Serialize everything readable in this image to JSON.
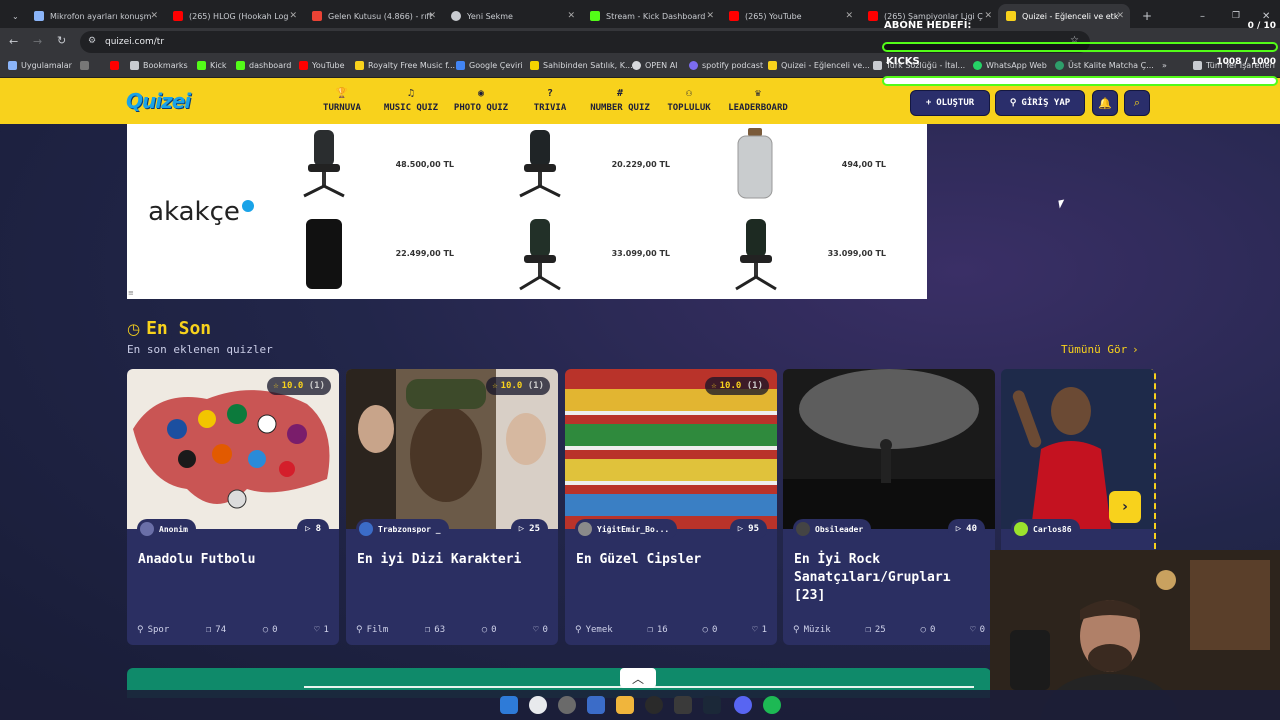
{
  "tabs": [
    {
      "title": "Mikrofon ayarları konuşm",
      "color": "#8ab4f8"
    },
    {
      "title": "(265) HLOG (Hookah Log",
      "color": "#ff0000"
    },
    {
      "title": "Gelen Kutusu (4.866) - rıft",
      "color": "#ea4335"
    },
    {
      "title": "Yeni Sekme",
      "color": "#c8cbd0"
    },
    {
      "title": "Stream - Kick Dashboard",
      "color": "#53fc18"
    },
    {
      "title": "(265) YouTube",
      "color": "#ff0000"
    },
    {
      "title": "(265) Şampiyonlar Ligi Ç",
      "color": "#ff0000"
    },
    {
      "title": "Quizei - Eğlenceli ve etk",
      "color": "#f8d21c"
    }
  ],
  "address": "quizei.com/tr",
  "bookmarks": [
    {
      "label": "Uygulamalar",
      "color": "#8ab4f8"
    },
    {
      "label": "",
      "color": "#ff0000"
    },
    {
      "label": "Bookmarks",
      "color": "#c8cbd0"
    },
    {
      "label": "Kick",
      "color": "#53fc18"
    },
    {
      "label": "dashboard",
      "color": "#53fc18"
    },
    {
      "label": "YouTube",
      "color": "#ff0000"
    },
    {
      "label": "Royalty Free Music f...",
      "color": "#f8d21c"
    },
    {
      "label": "Google Çeviri",
      "color": "#4285f4"
    },
    {
      "label": "Sahibinden Satılık, K...",
      "color": "#f5d300"
    },
    {
      "label": "OPEN AI",
      "color": "#d6d8dc"
    },
    {
      "label": "spotify podcast",
      "color": "#7c6cf0"
    },
    {
      "label": "Quizei - Eğlenceli ve...",
      "color": "#f8d21c"
    },
    {
      "label": "Türk Sözlüğü - İtal...",
      "color": "#c8cbd0"
    },
    {
      "label": "WhatsApp Web",
      "color": "#25d366"
    },
    {
      "label": "Üst Kalite Matcha Ç...",
      "color": "#2e9e6a"
    },
    {
      "label": "Tüm Yer İşaretleri",
      "color": "#c8cbd0"
    }
  ],
  "overlay": {
    "abone_label": "ABONE HEDEFİ:",
    "abone_count": "0 / 10",
    "kicks_label": "KICKS",
    "kicks_count": "1008 / 1000"
  },
  "site": {
    "logo": "Quizei",
    "nav": [
      {
        "label": "TURNUVA",
        "icon": "🏆"
      },
      {
        "label": "MUSIC QUIZ",
        "icon": "♫"
      },
      {
        "label": "PHOTO QUIZ",
        "icon": "◉"
      },
      {
        "label": "TRIVIA",
        "icon": "?"
      },
      {
        "label": "NUMBER QUIZ",
        "icon": "#"
      },
      {
        "label": "TOPLULUK",
        "icon": "⚇"
      },
      {
        "label": "LEADERBOARD",
        "icon": "♛"
      }
    ],
    "create_label": "OLUŞTUR",
    "login_label": "GİRİŞ YAP"
  },
  "ads": {
    "brand": "akakçe",
    "products": [
      {
        "price": "48.500,00 TL"
      },
      {
        "price": "20.229,00 TL"
      },
      {
        "price": "494,00 TL"
      },
      {
        "price": "22.499,00 TL"
      },
      {
        "price": "33.099,00 TL"
      },
      {
        "price": "33.099,00 TL"
      }
    ]
  },
  "section": {
    "title": "En Son",
    "subtitle": "En son eklenen quizler",
    "see_all": "Tümünü Gör"
  },
  "cards": [
    {
      "title": "Anadolu Futbolu",
      "rating": "10.0",
      "rating_count": "(1)",
      "author": "Anonim",
      "plays": "8",
      "category": "Spor",
      "questions": "74",
      "comments": "0",
      "likes": "1",
      "thumb": "#d9d2c8",
      "avatar": "#6a6fa8"
    },
    {
      "title": "En iyi Dizi Karakteri",
      "rating": "10.0",
      "rating_count": "(1)",
      "author": "Trabzonspor _",
      "plays": "25",
      "category": "Film",
      "questions": "63",
      "comments": "0",
      "likes": "0",
      "thumb": "#5a4a3a",
      "avatar": "#3b6cc8"
    },
    {
      "title": "En Güzel Cipsler",
      "rating": "10.0",
      "rating_count": "(1)",
      "author": "YiğitEmir_Bo...",
      "plays": "95",
      "category": "Yemek",
      "questions": "16",
      "comments": "0",
      "likes": "1",
      "thumb": "#c8493a",
      "avatar": "#8a8a8a"
    },
    {
      "title": "En İyi Rock Sanatçıları/Grupları [23]",
      "rating": "",
      "rating_count": "",
      "author": "Obsileader",
      "plays": "40",
      "category": "Müzik",
      "questions": "25",
      "comments": "0",
      "likes": "0",
      "thumb": "#2a2a2a",
      "avatar": "#444444"
    },
    {
      "title": "",
      "rating": "",
      "rating_count": "",
      "author": "Carlos86",
      "plays": "",
      "category": "",
      "questions": "",
      "comments": "",
      "likes": "",
      "thumb": "#b5121b",
      "avatar": "#9be22d"
    }
  ],
  "colors": {
    "accent": "#f8d21c",
    "nav_button": "#2a2e6b",
    "card": "#2b2f62",
    "brand_blue": "#1aa3e8"
  }
}
